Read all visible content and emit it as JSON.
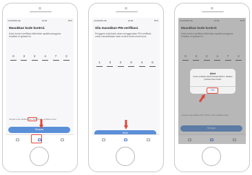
{
  "screens": [
    {
      "status": {
        "carrier": "••ll AXIATA 4G",
        "time": "14:03",
        "battery": "87%"
      },
      "title": "Masukkan kode kontrol.",
      "instructions": "Kartu kontrol verifikasi dikirimkan apabila pengguna terdaftar di aplikasi ini.",
      "code_digits": [
        "0",
        "3",
        "2",
        "4",
        "7",
        "2"
      ],
      "resend_text": "Jangan lupa aktifkan fitur SMS untuk verifikasi kode.",
      "submit_label": "Simpan",
      "tabs": [
        "home-icon",
        "card-icon",
        "settings-icon"
      ]
    },
    {
      "status": {
        "carrier": "••ll AXIATA 4G",
        "time": "14:03",
        "battery": "87%"
      },
      "title": "Sila masukkan PIN verifikasi.",
      "instructions": "Pengguna kode/kartu akan menggunakan PIN verifikasi untuk mendaftarkan kartu kontrol Anda untuk kunci.",
      "code_digits": [
        "1",
        "3",
        "2",
        "0",
        "4",
        "6"
      ],
      "submit_label": "Kirim",
      "tabs": [
        "home-icon",
        "card-icon",
        "settings-icon"
      ]
    },
    {
      "status": {
        "carrier": "••ll AXIATA 4G",
        "time": "14:03",
        "battery": "87%"
      },
      "title": "Masukkan kode kontrol.",
      "instructions": "Kartu kontrol verifikasi dikirimkan apabila pengguna terdaftar di aplikasi ini.",
      "code_digits": [
        "0",
        "3",
        "2",
        "4",
        "7",
        "2"
      ],
      "resend_text": "Jangan lupa aktifkan fitur SMS untuk verifikasi kode.",
      "submit_label": "Simpan",
      "tabs": [
        "home-icon",
        "card-icon",
        "settings-icon"
      ],
      "alert": {
        "title": "Alert",
        "message": "Kode verifikasi telah berhasil dikirim. Silakan periksa inbox Anda.",
        "ok_label": "OK"
      }
    }
  ],
  "colors": {
    "accent": "#5b8fd8",
    "highlight": "#e0473a",
    "overlay": "#5f5f5f"
  }
}
